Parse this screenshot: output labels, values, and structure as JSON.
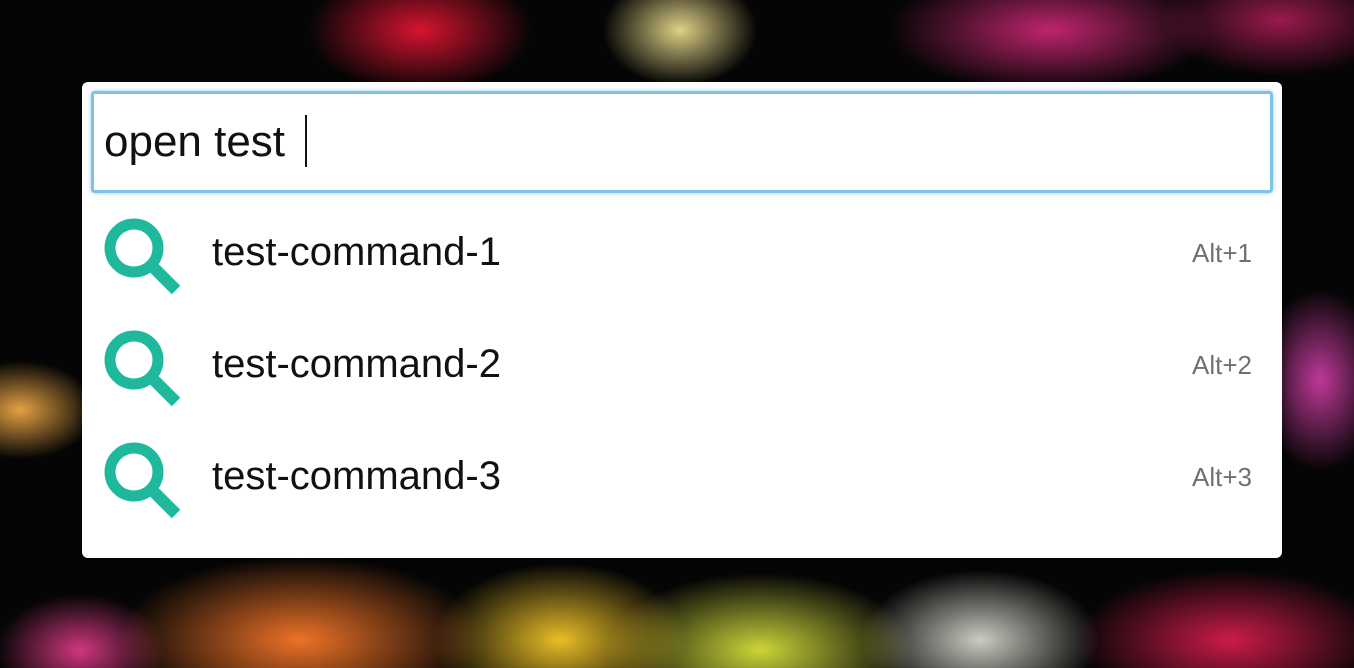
{
  "colors": {
    "accent": "#1fb89c",
    "focus_border": "#7ec3e6",
    "shortcut_text": "#707070",
    "panel_background": "#ffffff"
  },
  "search": {
    "value": "open test"
  },
  "results": [
    {
      "label": "test-command-1",
      "shortcut": "Alt+1",
      "icon": "search-icon"
    },
    {
      "label": "test-command-2",
      "shortcut": "Alt+2",
      "icon": "search-icon"
    },
    {
      "label": "test-command-3",
      "shortcut": "Alt+3",
      "icon": "search-icon"
    }
  ]
}
